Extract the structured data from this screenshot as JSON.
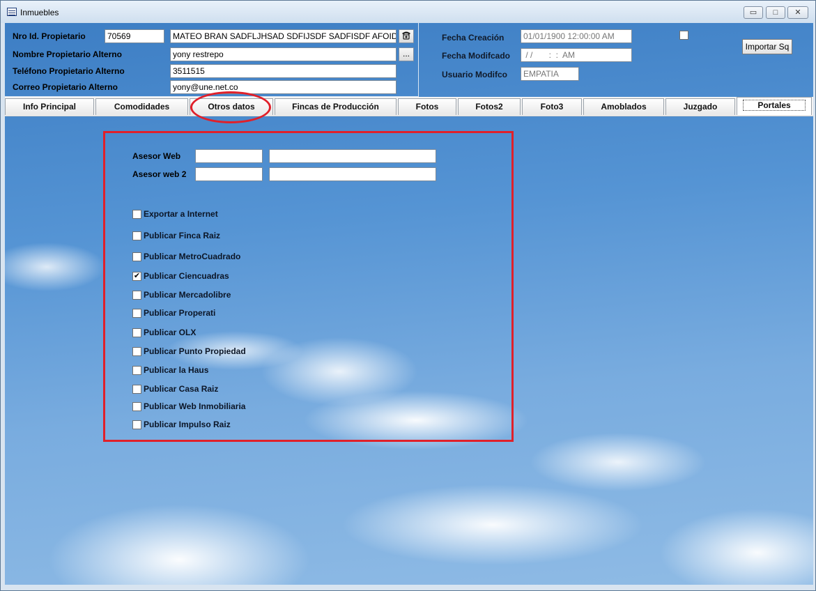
{
  "window": {
    "title": "Inmuebles",
    "controls": {
      "minimize": "▭",
      "maximize": "□",
      "close": "✕"
    }
  },
  "owner": {
    "id_label": "Nro Id. Propietario",
    "id_value": "70569",
    "name_value": "MATEO BRAN SADFLJHSAD SDFIJSDF SADFISDF AFOID",
    "alt_name_label": "Nombre Propietario Alterno",
    "alt_name_value": "yony restrepo",
    "alt_name_button": "...",
    "alt_phone_label": "Teléfono Propietario Alterno",
    "alt_phone_value": "3511515",
    "alt_email_label": "Correo Propietario Alterno",
    "alt_email_value": "yony@une.net.co"
  },
  "meta": {
    "created_label": "Fecha Creación",
    "created_value": "01/01/1900 12:00:00 AM",
    "modified_label": "Fecha Modifcado",
    "modified_value": " / /       :  :  AM",
    "user_label": "Usuario Modifco",
    "user_value": "EMPATIA",
    "import_button": "Importar Sq"
  },
  "tabs": [
    {
      "label": "Info Principal"
    },
    {
      "label": "Comodidades"
    },
    {
      "label": "Otros datos"
    },
    {
      "label": "Fincas de Producción"
    },
    {
      "label": "Fotos"
    },
    {
      "label": "Fotos2"
    },
    {
      "label": "Foto3"
    },
    {
      "label": "Amoblados"
    },
    {
      "label": "Juzgado"
    },
    {
      "label": "Portales"
    }
  ],
  "portales": {
    "advisor_web_label": "Asesor  Web",
    "advisor_web2_label": "Asesor  web 2",
    "options": [
      {
        "label": "Exportar a Internet",
        "checked": false
      },
      {
        "label": "Publicar Finca Raiz",
        "checked": false
      },
      {
        "label": "Publicar MetroCuadrado",
        "checked": false
      },
      {
        "label": "Publicar Ciencuadras",
        "checked": true
      },
      {
        "label": "Publicar Mercadolibre",
        "checked": false
      },
      {
        "label": "Publicar Properati",
        "checked": false
      },
      {
        "label": "Publicar OLX",
        "checked": false
      },
      {
        "label": "Publicar Punto Propiedad",
        "checked": false
      },
      {
        "label": "Publicar la Haus",
        "checked": false
      },
      {
        "label": "Publicar Casa Raiz",
        "checked": false
      },
      {
        "label": "Publicar Web Inmobiliaria",
        "checked": false
      },
      {
        "label": "Publicar Impulso Raiz",
        "checked": false
      }
    ],
    "check_mark": "✔"
  }
}
